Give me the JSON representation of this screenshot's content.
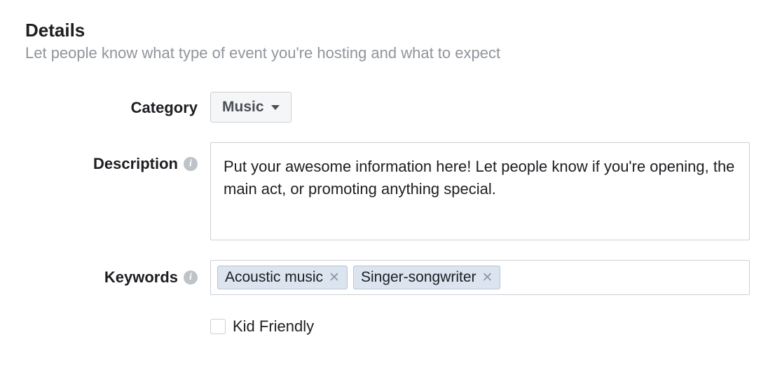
{
  "section": {
    "title": "Details",
    "subtitle": "Let people know what type of event you're hosting and what to expect"
  },
  "category": {
    "label": "Category",
    "selected": "Music"
  },
  "description": {
    "label": "Description",
    "value": "Put your awesome information here! Let people know if you're opening, the main act, or promoting anything special."
  },
  "keywords": {
    "label": "Keywords",
    "tags": [
      "Acoustic music",
      "Singer-songwriter"
    ]
  },
  "kidfriendly": {
    "label": "Kid Friendly",
    "checked": false
  }
}
